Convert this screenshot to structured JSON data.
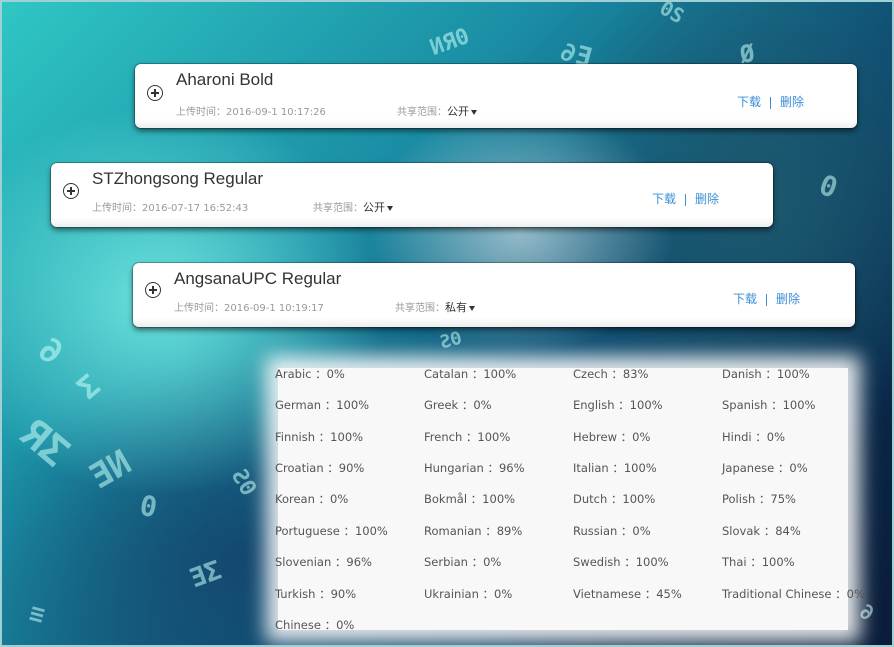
{
  "fonts": [
    {
      "name": "Aharoni Bold",
      "upload_time": "上传时间：2016-09-1 10:17:26",
      "share_label": "共享范围：",
      "share_value": "公开",
      "download": "下载",
      "delete": "删除"
    },
    {
      "name": "STZhongsong Regular",
      "upload_time": "上传时间：2016-07-17 16:52:43",
      "share_label": "共享范围：",
      "share_value": "公开",
      "download": "下载",
      "delete": "删除"
    },
    {
      "name": "AngsanaUPC Regular",
      "upload_time": "上传时间：2016-09-1 10:19:17",
      "share_label": "共享范围：",
      "share_value": "私有",
      "download": "下载",
      "delete": "删除"
    }
  ],
  "languages": [
    [
      "Arabic ：0%",
      "Catalan ：100%",
      "Czech ：83%",
      "Danish ：100%"
    ],
    [
      "German ：100%",
      "Greek ：0%",
      "English ：100%",
      "Spanish ：100%"
    ],
    [
      "Finnish ：100%",
      "French ：100%",
      "Hebrew ：0%",
      "Hindi ：0%"
    ],
    [
      "Croatian ：90%",
      "Hungarian ：96%",
      "Italian ：100%",
      "Japanese ：0%"
    ],
    [
      "Korean ：0%",
      "Bokmål ：100%",
      "Dutch ：100%",
      "Polish ：75%"
    ],
    [
      "Portuguese ：100%",
      "Romanian ：89%",
      "Russian ：0%",
      "Slovak ：84%"
    ],
    [
      "Slovenian ：96%",
      "Serbian ：0%",
      "Swedish ：100%",
      "Thai ：100%"
    ],
    [
      "Turkish ：90%",
      "Ukrainian ：0%",
      "Vietnamese ：45%",
      "Traditional Chinese ：0%"
    ],
    [
      "Chinese ：0%"
    ]
  ],
  "colors": {
    "link": "#3a8fd6",
    "text": "#333333",
    "muted": "#999999"
  },
  "icons": {
    "expand": "plus-circle-icon",
    "dropdown": "caret-down-icon"
  }
}
